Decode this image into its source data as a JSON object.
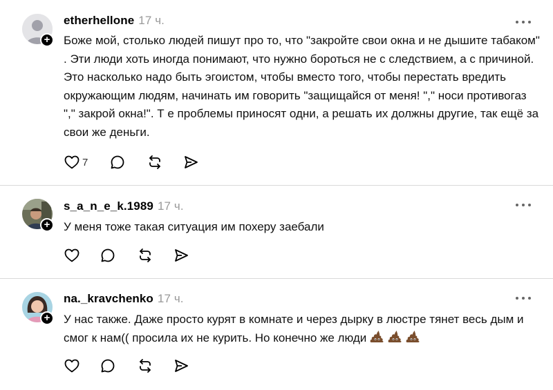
{
  "posts": [
    {
      "username": "etherhellone",
      "time": "17 ч.",
      "text": "Боже мой, столько людей пишут про то, что \"закройте свои окна и не дышите табаком\" . Эти люди хоть иногда понимают, что нужно бороться не с следствием, а с причиной. Это насколько надо быть эгоистом, чтобы вместо того, чтобы перестать вредить окружающим людям, начинать им говорить \"защищайся от меня! \",\" носи противогаз \",\" закрой окна!\". Т е проблемы приносят одни, а решать их должны другие, так ещё за свои же деньги.",
      "likes": "7",
      "avatar_icon": "default-user-avatar"
    },
    {
      "username": "s_a_n_e_k.1989",
      "time": "17 ч.",
      "text": "У меня тоже такая ситуация им похеру заебали",
      "avatar_icon": "photo-avatar"
    },
    {
      "username": "na._kravchenko",
      "time": "17 ч.",
      "text": "У нас также. Даже просто курят в комнате и через дырку в люстре тянет весь дым и смог к нам(( просила их не курить. Но конечно же люди",
      "emoji": [
        "poop-emoji",
        "poop-emoji",
        "poop-emoji"
      ],
      "avatar_icon": "photo-avatar"
    }
  ],
  "icons": {
    "like": "heart-icon",
    "reply": "comment-icon",
    "repost": "repost-icon",
    "share": "share-icon",
    "more": "more-icon",
    "follow": "plus-icon"
  },
  "colors": {
    "text": "#111111",
    "muted": "#999999",
    "divider": "#d9d9d9",
    "icon": "#000000"
  }
}
